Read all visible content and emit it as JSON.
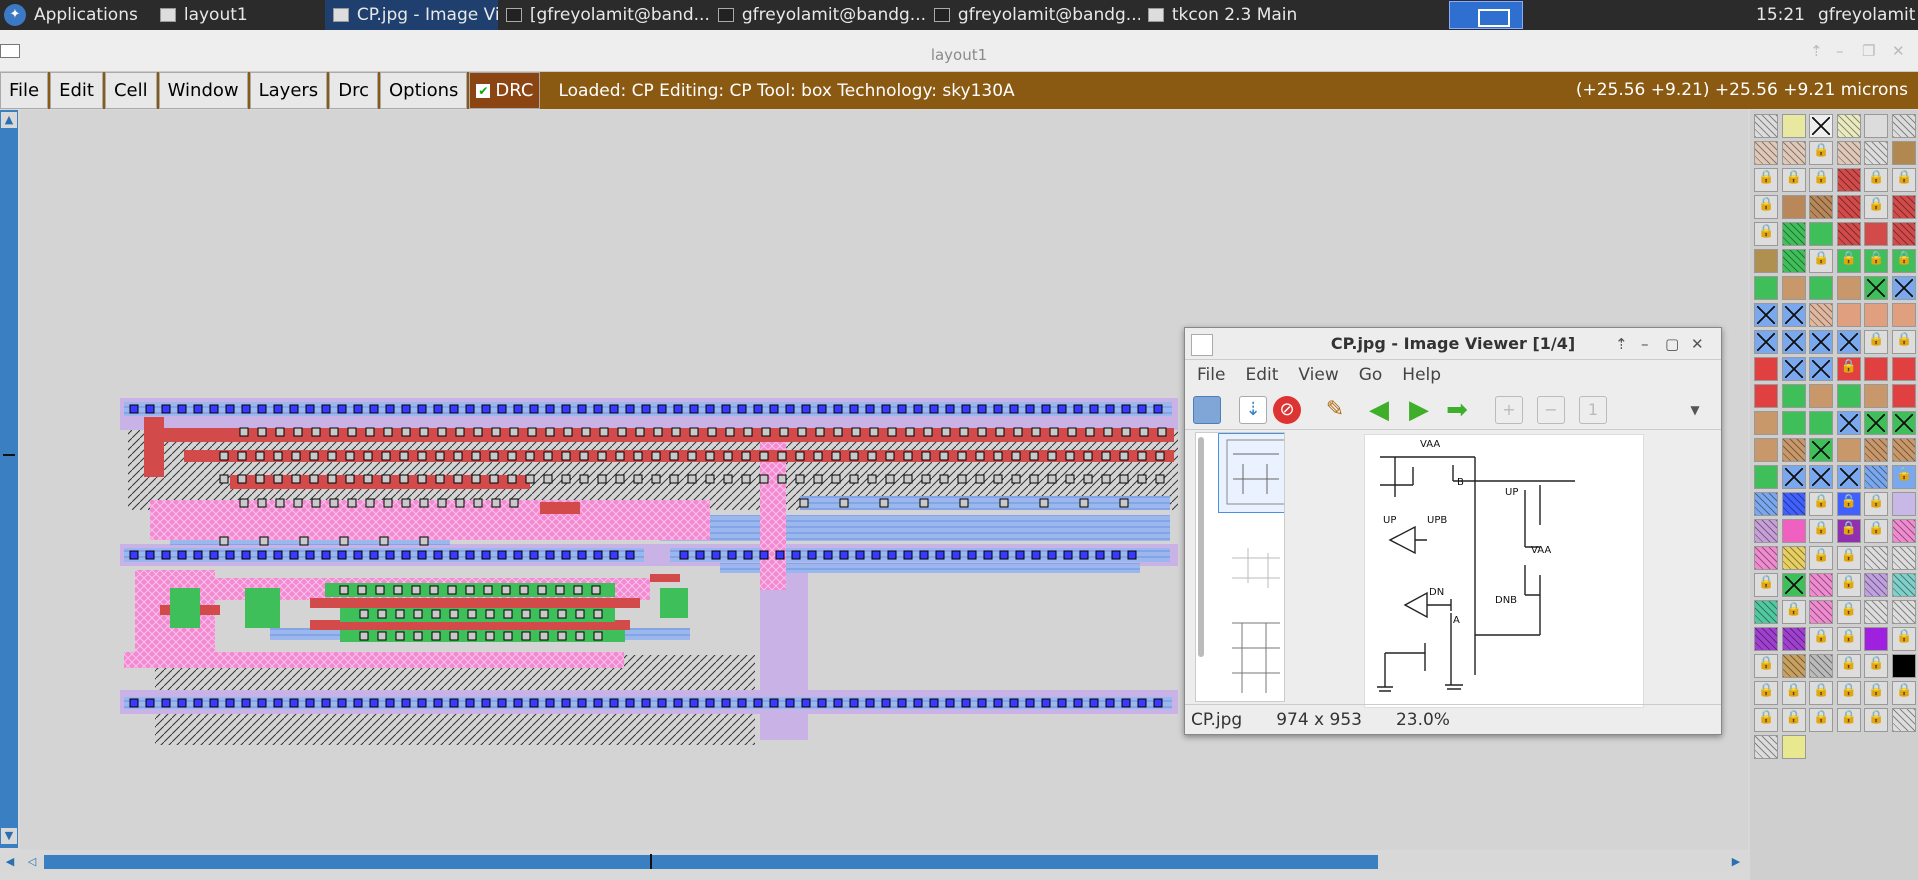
{
  "taskbar": {
    "apps_label": "Applications",
    "tasks": [
      {
        "label": "layout1",
        "icon": "window-icon"
      },
      {
        "label": "CP.jpg - Image View...",
        "icon": "image-icon",
        "active": true
      },
      {
        "label": "[gfreyolamit@band...",
        "icon": "terminal-icon"
      },
      {
        "label": "gfreyolamit@bandg...",
        "icon": "terminal-icon"
      },
      {
        "label": "gfreyolamit@bandg...",
        "icon": "terminal-icon"
      },
      {
        "label": "tkcon 2.3 Main",
        "icon": "window-icon"
      }
    ],
    "clock": "15:21",
    "user": "gfreyolamit"
  },
  "window": {
    "title": "layout1",
    "menu": [
      "File",
      "Edit",
      "Cell",
      "Window",
      "Layers",
      "Drc",
      "Options"
    ],
    "drc_label": "DRC",
    "drc_checked": true,
    "status": "Loaded: CP Editing: CP Tool: box  Technology: sky130A",
    "coords": "(+25.56 +9.21) +25.56 +9.21 microns",
    "accent": "#8b5a12"
  },
  "viewer": {
    "title": "CP.jpg - Image Viewer [1/4]",
    "menu": [
      "File",
      "Edit",
      "View",
      "Go",
      "Help"
    ],
    "filename": "CP.jpg",
    "dimensions": "974 x 953",
    "zoom": "23.0%",
    "schematic_labels": {
      "vaa_top": "VAA",
      "b": "B",
      "up_left": "UP",
      "upb": "UPB",
      "up_right": "UP",
      "vaa_right": "VAA",
      "dn": "DN",
      "a": "A",
      "dnb": "DNB"
    }
  }
}
